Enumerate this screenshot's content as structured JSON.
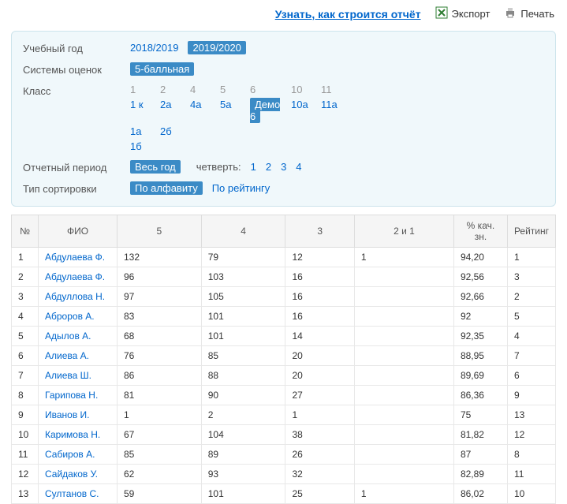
{
  "toolbar": {
    "report_link": "Узнать, как строится отчёт",
    "export": "Экспорт",
    "print": "Печать"
  },
  "filters": {
    "year": {
      "label": "Учебный год",
      "options": [
        "2018/2019",
        "2019/2020"
      ],
      "selected": "2019/2020"
    },
    "grading": {
      "label": "Системы оценок",
      "selected": "5-балльная"
    },
    "class_label": "Класс",
    "class_header": [
      "1",
      "2",
      "4",
      "5",
      "6",
      "10",
      "11"
    ],
    "class_row1": [
      "1 к",
      "2а",
      "4а",
      "5а",
      "Демо 6",
      "10а",
      "11а"
    ],
    "class_row2": [
      "1а",
      "2б"
    ],
    "class_row3": [
      "1б"
    ],
    "class_selected": "Демо 6",
    "period": {
      "label": "Отчетный период",
      "selected": "Весь год",
      "quarter_label": "четверть:",
      "quarters": [
        "1",
        "2",
        "3",
        "4"
      ]
    },
    "sort": {
      "label": "Тип сортировки",
      "options": [
        "По алфавиту",
        "По рейтингу"
      ],
      "selected": "По алфавиту"
    }
  },
  "table": {
    "headers": [
      "№",
      "ФИО",
      "5",
      "4",
      "3",
      "2 и 1",
      "% кач. зн.",
      "Рейтинг"
    ],
    "rows": [
      {
        "n": "1",
        "name": "Абдулаева Ф.",
        "c5": "132",
        "c4": "79",
        "c3": "12",
        "c21": "1",
        "pct": "94,20",
        "rank": "1"
      },
      {
        "n": "2",
        "name": "Абдулаева Ф.",
        "c5": "96",
        "c4": "103",
        "c3": "16",
        "c21": "",
        "pct": "92,56",
        "rank": "3"
      },
      {
        "n": "3",
        "name": "Абдуллова Н.",
        "c5": "97",
        "c4": "105",
        "c3": "16",
        "c21": "",
        "pct": "92,66",
        "rank": "2"
      },
      {
        "n": "4",
        "name": "Аброров А.",
        "c5": "83",
        "c4": "101",
        "c3": "16",
        "c21": "",
        "pct": "92",
        "rank": "5"
      },
      {
        "n": "5",
        "name": "Адылов А.",
        "c5": "68",
        "c4": "101",
        "c3": "14",
        "c21": "",
        "pct": "92,35",
        "rank": "4"
      },
      {
        "n": "6",
        "name": "Алиева А.",
        "c5": "76",
        "c4": "85",
        "c3": "20",
        "c21": "",
        "pct": "88,95",
        "rank": "7"
      },
      {
        "n": "7",
        "name": "Алиева Ш.",
        "c5": "86",
        "c4": "88",
        "c3": "20",
        "c21": "",
        "pct": "89,69",
        "rank": "6"
      },
      {
        "n": "8",
        "name": "Гарипова Н.",
        "c5": "81",
        "c4": "90",
        "c3": "27",
        "c21": "",
        "pct": "86,36",
        "rank": "9"
      },
      {
        "n": "9",
        "name": "Иванов И.",
        "c5": "1",
        "c4": "2",
        "c3": "1",
        "c21": "",
        "pct": "75",
        "rank": "13"
      },
      {
        "n": "10",
        "name": "Каримова Н.",
        "c5": "67",
        "c4": "104",
        "c3": "38",
        "c21": "",
        "pct": "81,82",
        "rank": "12"
      },
      {
        "n": "11",
        "name": "Сабиров А.",
        "c5": "85",
        "c4": "89",
        "c3": "26",
        "c21": "",
        "pct": "87",
        "rank": "8"
      },
      {
        "n": "12",
        "name": "Сайдаков У.",
        "c5": "62",
        "c4": "93",
        "c3": "32",
        "c21": "",
        "pct": "82,89",
        "rank": "11"
      },
      {
        "n": "13",
        "name": "Султанов С.",
        "c5": "59",
        "c4": "101",
        "c3": "25",
        "c21": "1",
        "pct": "86,02",
        "rank": "10"
      }
    ]
  }
}
